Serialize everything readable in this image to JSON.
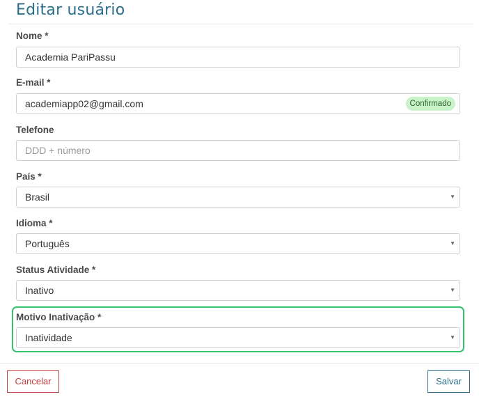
{
  "page": {
    "title": "Editar usuário"
  },
  "form": {
    "nome": {
      "label": "Nome *",
      "value": "Academia PariPassu"
    },
    "email": {
      "label": "E-mail *",
      "value": "academiapp02@gmail.com",
      "badge": "Confirmado"
    },
    "telefone": {
      "label": "Telefone",
      "placeholder": "DDD + número"
    },
    "pais": {
      "label": "País *",
      "value": "Brasil"
    },
    "idioma": {
      "label": "Idioma *",
      "value": "Português"
    },
    "status": {
      "label": "Status Atividade *",
      "value": "Inativo"
    },
    "motivo": {
      "label": "Motivo Inativação *",
      "value": "Inatividade"
    }
  },
  "footer": {
    "cancel_label": "Cancelar",
    "save_label": "Salvar"
  },
  "colors": {
    "accent": "#2a6e8c",
    "danger": "#c43c3c",
    "success_badge": "#c8f2c8",
    "highlight": "#34c26c"
  },
  "icons": {
    "select_caret": "chevron-down-icon"
  }
}
